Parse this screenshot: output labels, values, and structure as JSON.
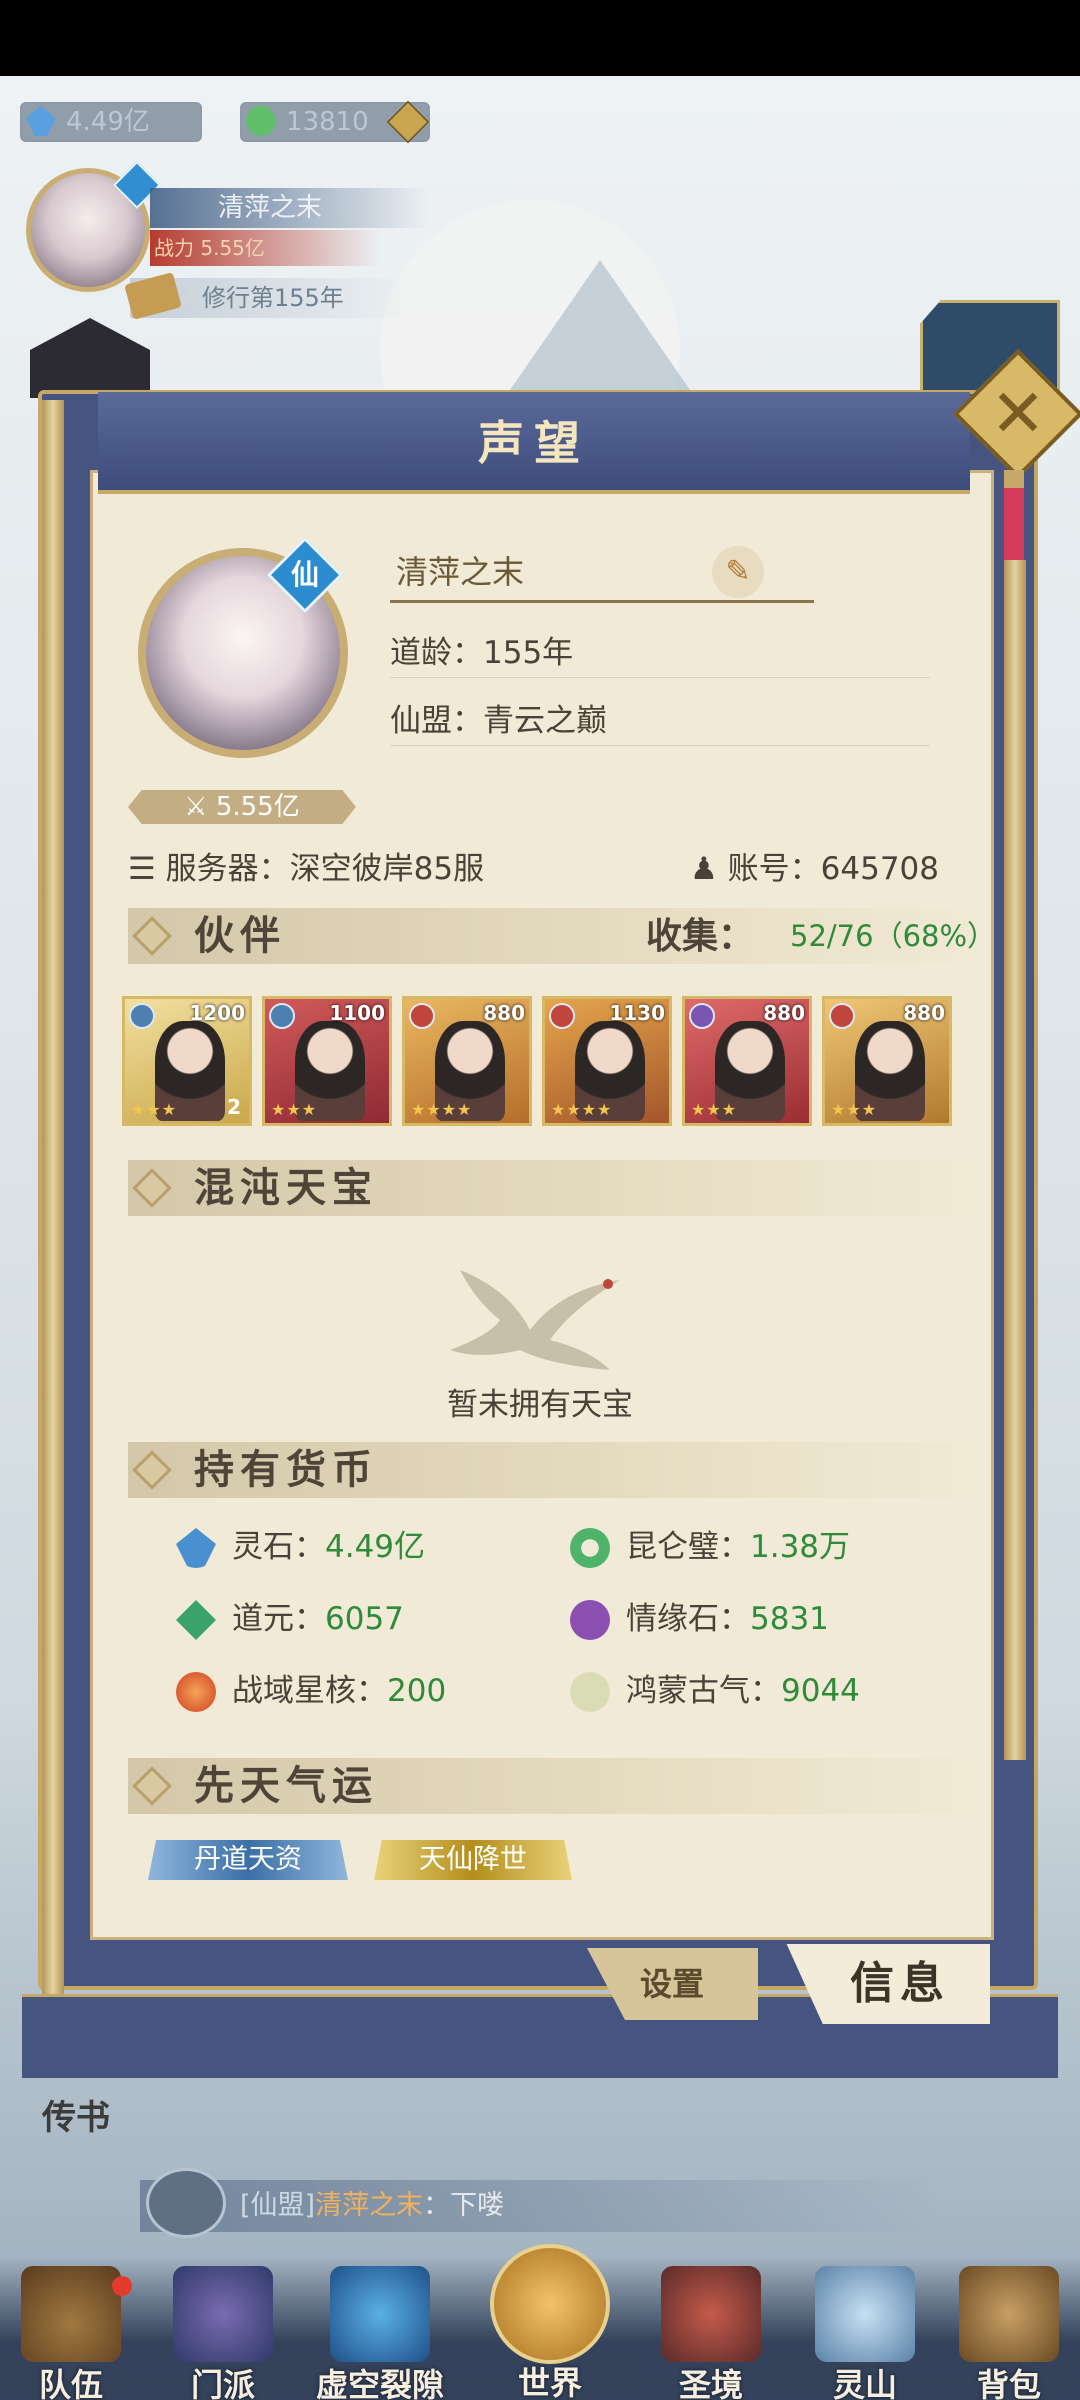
{
  "topbar": {
    "spirit_stone": "4.49亿",
    "jade": "13810"
  },
  "player": {
    "name": "清萍之末",
    "power_label": "战力",
    "power": "5.55亿",
    "years": "修行第155年"
  },
  "dialog": {
    "title": "声望",
    "profile": {
      "name": "清萍之末",
      "badge": "仙",
      "age": "道龄：155年",
      "alliance": "仙盟：青云之巅",
      "power": "5.55亿",
      "server": "服务器：深空彼岸85服",
      "account": "账号：645708"
    },
    "partners": {
      "title": "伙伴",
      "collect_label": "收集：",
      "collect_value": "52/76（68%）",
      "cards": [
        {
          "level": "1200",
          "stars": "★★★",
          "extra": "2"
        },
        {
          "level": "1100",
          "stars": "★★★",
          "extra": ""
        },
        {
          "level": "880",
          "stars": "★★★★",
          "extra": ""
        },
        {
          "level": "1130",
          "stars": "★★★★",
          "extra": ""
        },
        {
          "level": "880",
          "stars": "★★★",
          "extra": ""
        },
        {
          "level": "880",
          "stars": "★★★",
          "extra": ""
        }
      ]
    },
    "chaos": {
      "title": "混沌天宝",
      "empty_text": "暂未拥有天宝"
    },
    "currency": {
      "title": "持有货币",
      "items": [
        {
          "label": "灵石：",
          "value": "4.49亿",
          "icon": "spirit-stone-icon",
          "color": "#4a8fd0"
        },
        {
          "label": "昆仑璧：",
          "value": "1.38万",
          "icon": "kunlun-jade-icon",
          "color": "#4fb36a"
        },
        {
          "label": "道元：",
          "value": "6057",
          "icon": "dao-essence-icon",
          "color": "#3aa36a"
        },
        {
          "label": "情缘石：",
          "value": "5831",
          "icon": "love-stone-icon",
          "color": "#8a4fb0"
        },
        {
          "label": "战域星核：",
          "value": "200",
          "icon": "star-core-icon",
          "color": "#e0532a"
        },
        {
          "label": "鸿蒙古气：",
          "value": "9044",
          "icon": "primal-qi-icon",
          "color": "#cfd6a8"
        }
      ]
    },
    "luck": {
      "title": "先天气运",
      "tags": [
        "丹道天资",
        "天仙降世"
      ]
    },
    "tabs": {
      "settings": "设置",
      "info": "信息"
    }
  },
  "side": {
    "left_text": "传书"
  },
  "chat": {
    "tag": "[仙盟]",
    "name": "清萍之末",
    "message": "：下喽"
  },
  "nav": [
    "队伍",
    "门派",
    "虚空裂隙",
    "世界",
    "圣境",
    "灵山",
    "背包"
  ]
}
